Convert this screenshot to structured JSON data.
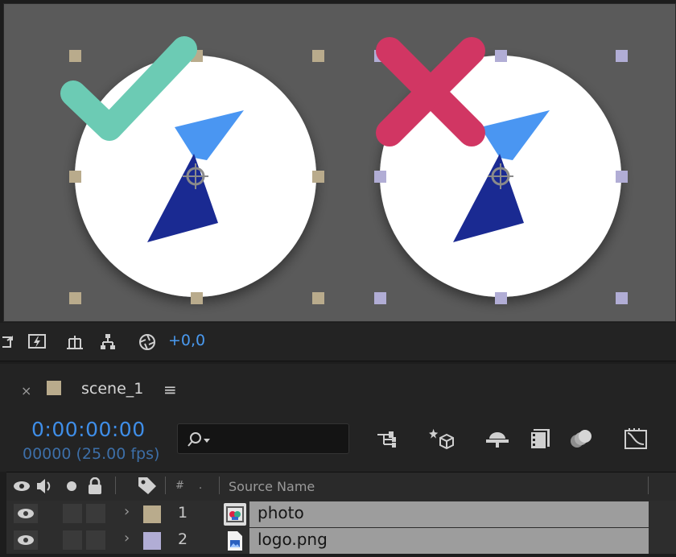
{
  "colors": {
    "label_tan": "#b9ab8c",
    "label_lavender": "#b1add5",
    "check_teal": "#6ccbb4",
    "cross_red": "#d13663",
    "timecode_blue": "#3f8ee8",
    "selection_gray": "#9d9d9d"
  },
  "viewer": {
    "icons": [
      "checkmark-icon",
      "cross-icon",
      "clock-face",
      "anchor-point-icon"
    ]
  },
  "toolbar": {
    "icons": [
      "snapshot-icon",
      "fast-preview-icon",
      "timeline-flowchart-icon",
      "composition-flowchart-icon",
      "exposure-icon"
    ],
    "exposure_value": "+0,0"
  },
  "panel": {
    "close_glyph": "×",
    "tab_label": "scene_1",
    "menu_glyph": "≡"
  },
  "controls": {
    "timecode": "0:00:00:00",
    "frame_fps": "00000 (25.00 fps)",
    "search_placeholder": ""
  },
  "columns": {
    "number": "#",
    "source_name": "Source Name"
  },
  "layers": [
    {
      "number": "1",
      "name": "photo",
      "label_color": "#b9ab8c",
      "icon": "composition-icon"
    },
    {
      "number": "2",
      "name": "logo.png",
      "label_color": "#b1add5",
      "icon": "image-file-icon"
    }
  ]
}
